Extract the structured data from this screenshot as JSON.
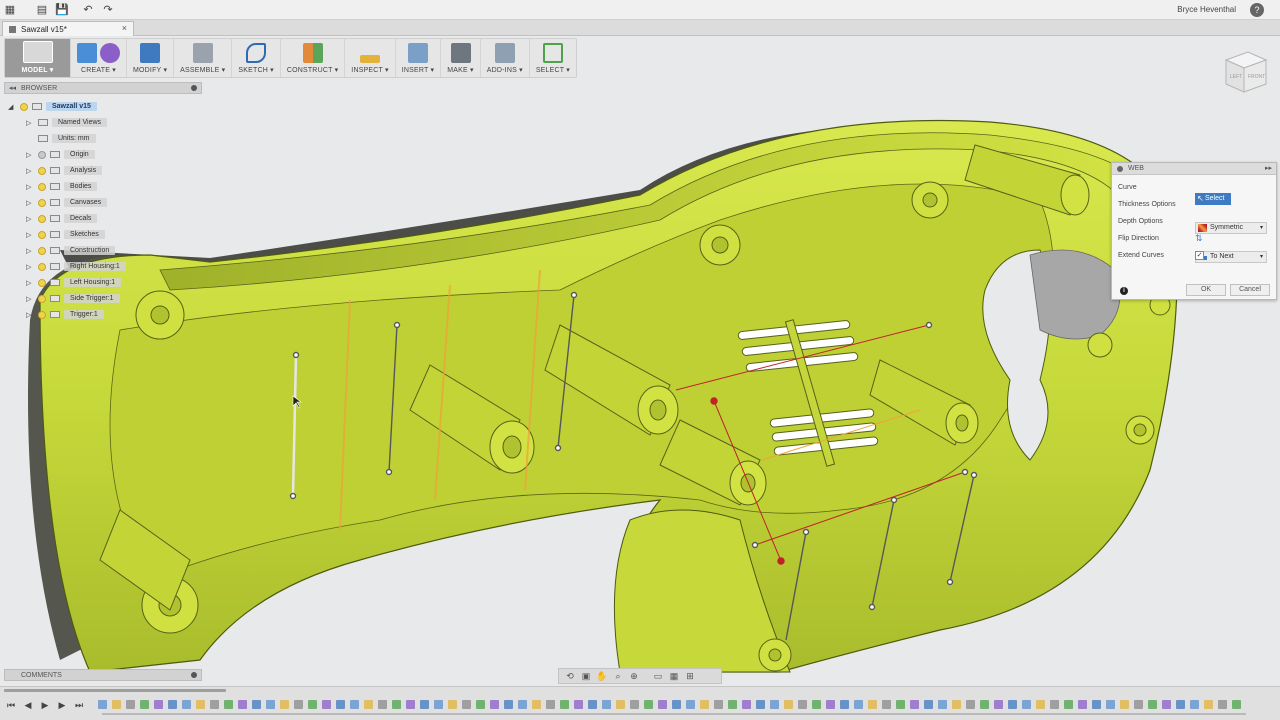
{
  "app": {
    "user_name": "Bryce Heventhal",
    "help_label": "?",
    "document_tab": "Sawzall v15*",
    "tab_close": "×"
  },
  "toolbar": {
    "model": "MODEL ▾",
    "create": "CREATE ▾",
    "modify": "MODIFY ▾",
    "assemble": "ASSEMBLE ▾",
    "sketch": "SKETCH ▾",
    "construct": "CONSTRUCT ▾",
    "inspect": "INSPECT ▾",
    "insert": "INSERT ▾",
    "make": "MAKE ▾",
    "add_ins": "ADD-INS ▾",
    "select": "SELECT ▾"
  },
  "browser": {
    "header": "BROWSER",
    "collapse_arrow": "◂◂",
    "items": [
      {
        "label": "Sawzall v15",
        "selected": true
      },
      {
        "label": "Named Views"
      },
      {
        "label": "Units: mm"
      },
      {
        "label": "Origin"
      },
      {
        "label": "Analysis"
      },
      {
        "label": "Bodies"
      },
      {
        "label": "Canvases"
      },
      {
        "label": "Decals"
      },
      {
        "label": "Sketches"
      },
      {
        "label": "Construction"
      },
      {
        "label": "Right Housing:1"
      },
      {
        "label": "Left Housing:1"
      },
      {
        "label": "Side Trigger:1"
      },
      {
        "label": "Trigger:1"
      }
    ]
  },
  "viewcube": {
    "left_face": "LEFT",
    "front_face": "FRONT"
  },
  "web_dialog": {
    "title": "WEB",
    "rows": {
      "curve_label": "Curve",
      "curve_value": "Select",
      "thickness_label": "Thickness Options",
      "thickness_value": "Symmetric",
      "depth_label": "Depth Options",
      "depth_value": "To Next",
      "flip_label": "Flip Direction",
      "extend_label": "Extend Curves",
      "extend_checked": "✓"
    },
    "info_icon": "i",
    "ok": "OK",
    "cancel": "Cancel"
  },
  "comments": {
    "header": "COMMENTS"
  },
  "colors": {
    "part_green": "#c9dc3a",
    "part_shadow": "#6f7d17",
    "selection_blue": "#3d7cc4",
    "sketch_orange": "#f0a23a",
    "sketch_red": "#c0222a"
  }
}
